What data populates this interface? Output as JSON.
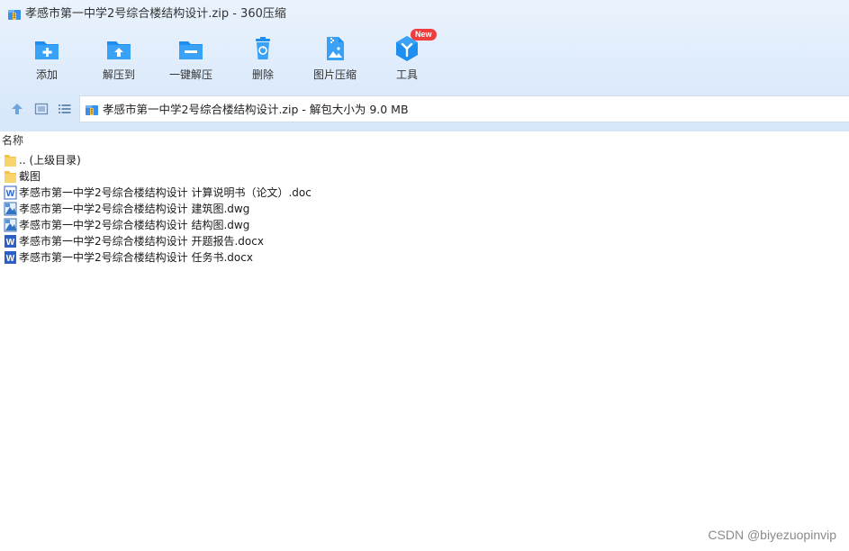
{
  "window": {
    "title": "孝感市第一中学2号综合楼结构设计.zip - 360压缩"
  },
  "toolbar": {
    "buttons": [
      {
        "label": "添加",
        "icon": "add-folder-icon"
      },
      {
        "label": "解压到",
        "icon": "extract-to-icon"
      },
      {
        "label": "一键解压",
        "icon": "one-click-extract-icon"
      },
      {
        "label": "删除",
        "icon": "recycle-bin-icon"
      },
      {
        "label": "图片压缩",
        "icon": "image-compress-icon"
      },
      {
        "label": "工具",
        "icon": "tools-icon",
        "badge": "New"
      }
    ]
  },
  "address": {
    "text": "孝感市第一中学2号综合楼结构设计.zip - 解包大小为 9.0 MB"
  },
  "list": {
    "column_name": "名称",
    "rows": [
      {
        "name": ".. (上级目录)",
        "type": "folder"
      },
      {
        "name": "截图",
        "type": "folder"
      },
      {
        "name": "孝感市第一中学2号综合楼结构设计 计算说明书（论文）.doc",
        "type": "doc"
      },
      {
        "name": "孝感市第一中学2号综合楼结构设计 建筑图.dwg",
        "type": "dwg"
      },
      {
        "name": "孝感市第一中学2号综合楼结构设计 结构图.dwg",
        "type": "dwg"
      },
      {
        "name": "孝感市第一中学2号综合楼结构设计 开题报告.docx",
        "type": "docx"
      },
      {
        "name": "孝感市第一中学2号综合楼结构设计 任务书.docx",
        "type": "docx"
      }
    ]
  },
  "watermark": "CSDN @biyezuopinvip",
  "colors": {
    "accent": "#1e8ef0",
    "badge": "#f03c3c",
    "folder": "#f5c242",
    "word": "#2b5fc7"
  }
}
